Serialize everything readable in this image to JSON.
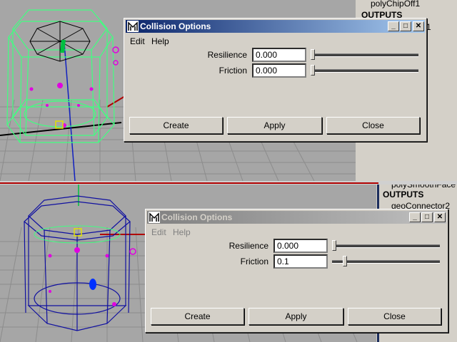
{
  "viewport_top": {
    "outliner": {
      "node_name": "polyChipOff1",
      "outputs_label": "OUTPUTS",
      "partial_name": "1"
    }
  },
  "viewport_bottom": {
    "outliner": {
      "node_name": "polySmoothFace",
      "outputs_label": "OUTPUTS",
      "connector_name": "geoConnector2"
    }
  },
  "dialog_active": {
    "title": "Collision Options",
    "menu": [
      "Edit",
      "Help"
    ],
    "fields": [
      {
        "label": "Resilience",
        "value": "0.000",
        "slider_fraction": 0.0
      },
      {
        "label": "Friction",
        "value": "0.000",
        "slider_fraction": 0.0
      }
    ],
    "buttons": {
      "create": "Create",
      "apply": "Apply",
      "close": "Close"
    },
    "title_buttons": {
      "minimize": "_",
      "maximize": "□",
      "close": "✕"
    }
  },
  "dialog_inactive": {
    "title": "Collision Options",
    "menu": [
      "Edit",
      "Help"
    ],
    "fields": [
      {
        "label": "Resilience",
        "value": "0.000",
        "slider_fraction": 0.0
      },
      {
        "label": "Friction",
        "value": "0.1",
        "slider_fraction": 0.1
      }
    ],
    "buttons": {
      "create": "Create",
      "apply": "Apply",
      "close": "Close"
    },
    "title_buttons": {
      "minimize": "_",
      "maximize": "□",
      "close": "✕"
    }
  },
  "colors": {
    "active_title_start": "#0a246a",
    "inactive_title_start": "#808080",
    "wireframe_green": "#40ff80",
    "wireframe_blue": "#1010a0",
    "accent_magenta": "#e000e0"
  }
}
